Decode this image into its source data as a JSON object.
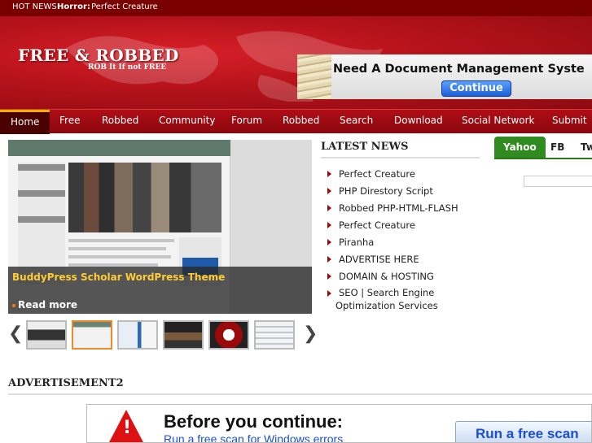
{
  "hot_news": {
    "label": "HOT NEWS",
    "category": "Horror:",
    "title": "Perfect Creature"
  },
  "site": {
    "title": "FREE & ROBBED",
    "tagline": "ROB It If not FREE"
  },
  "banner_ad": {
    "text": "Need A Document Management Syste",
    "button": "Continue"
  },
  "nav": {
    "items": [
      {
        "label": "Home",
        "active": true
      },
      {
        "label": "Free"
      },
      {
        "label": "Robbed"
      },
      {
        "label": "Community"
      },
      {
        "label": "Forum"
      },
      {
        "label": "Robbed"
      },
      {
        "label": "Search"
      },
      {
        "label": "Download"
      },
      {
        "label": "Social Network"
      },
      {
        "label": "Submit"
      }
    ]
  },
  "slider": {
    "caption": "BuddyPress Scholar WordPress Theme",
    "read_more": "Read more",
    "prev_icon": "chevron-left-icon",
    "next_icon": "chevron-right-icon",
    "selected_thumb": 1
  },
  "latest_news": {
    "title": "LATEST NEWS",
    "items": [
      "Perfect Creature",
      "PHP Direstory Script",
      "Robbed PHP-HTML-FLASH",
      "Perfect Creature",
      "Piranha",
      "ADVERTISE HERE",
      "DOMAIN & HOSTING"
    ],
    "last_item": {
      "line1": "SEO | Search Engine",
      "line2": "Optimization Services"
    }
  },
  "tabs": {
    "items": [
      "Yahoo",
      "FB",
      "Tw"
    ],
    "active": "Yahoo"
  },
  "advertisement2": {
    "title": "ADVERTISEMENT2",
    "headline": "Before you continue:",
    "subline": "Run a free scan for Windows errors",
    "button": "Run a free scan"
  },
  "colors": {
    "brand_red": "#b5121b",
    "dark_red": "#7a0000",
    "accent_gold": "#f0b400",
    "tab_green": "#2f8a1f",
    "caption_yellow": "#ffcc33"
  }
}
